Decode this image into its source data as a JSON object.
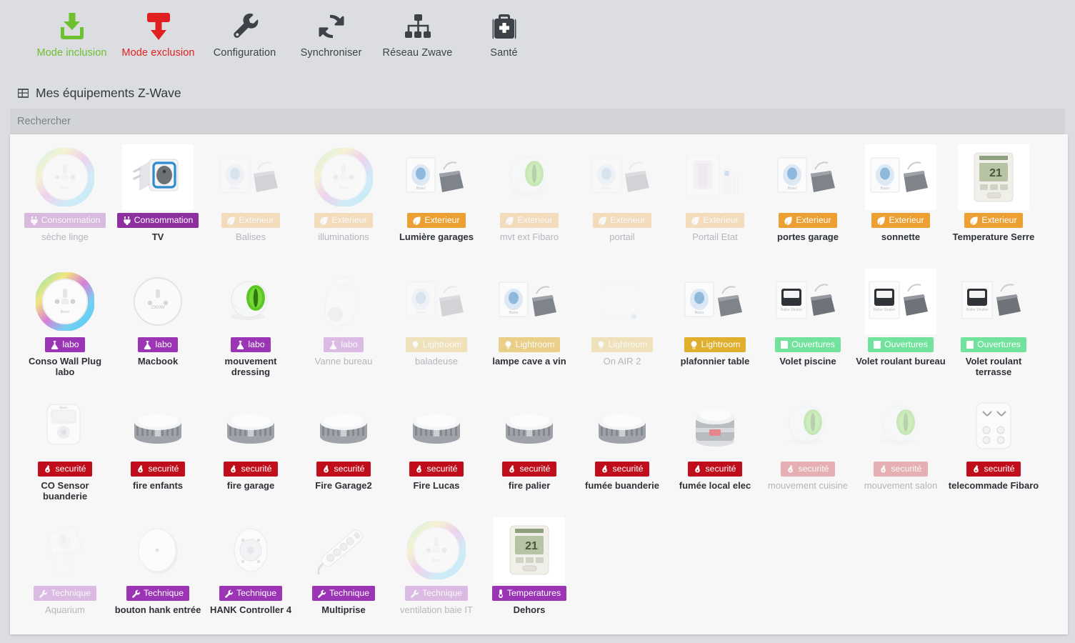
{
  "toolbar": [
    {
      "label": "Mode inclusion",
      "icon": "download-arrow-icon",
      "tone": "green"
    },
    {
      "label": "Mode exclusion",
      "icon": "upload-arrow-icon",
      "tone": "red"
    },
    {
      "label": "Configuration",
      "icon": "wrench-icon",
      "tone": "dark"
    },
    {
      "label": "Synchroniser",
      "icon": "sync-icon",
      "tone": "dark"
    },
    {
      "label": "Réseau Zwave",
      "icon": "sitemap-icon",
      "tone": "dark"
    },
    {
      "label": "Santé",
      "icon": "medical-bag-icon",
      "tone": "dark"
    }
  ],
  "section": {
    "icon": "grid-icon",
    "title": "Mes équipements Z-Wave"
  },
  "search": {
    "placeholder": "Rechercher",
    "value": ""
  },
  "categories": {
    "Consommation": {
      "color": "#8e2fa0",
      "icon": "plug-icon"
    },
    "Exterieur": {
      "color": "#eca033",
      "icon": "leaf-icon"
    },
    "labo": {
      "color": "#9c35b5",
      "icon": "flask-icon"
    },
    "Lightroom": {
      "color": "#e0af2e",
      "icon": "bulb-icon"
    },
    "Ouvertures": {
      "color": "#72e39c",
      "icon": "door-icon"
    },
    "securité": {
      "color": "#bf0d1c",
      "icon": "fire-icon"
    },
    "Technique": {
      "color": "#9c35b5",
      "icon": "wrench-icon"
    },
    "Temperatures": {
      "color": "#9c35b5",
      "icon": "thermometer-icon"
    }
  },
  "devices": [
    {
      "name": "sèche linge",
      "badge": "Consommation",
      "state": "off",
      "image": "wallplug-led"
    },
    {
      "name": "TV",
      "badge": "Consommation",
      "state": "on",
      "image": "smartplug-blue",
      "boxed": true
    },
    {
      "name": "Balises",
      "badge": "Exterieur",
      "state": "off",
      "image": "module-box"
    },
    {
      "name": "illuminations",
      "badge": "Exterieur",
      "state": "off",
      "image": "wallplug-led"
    },
    {
      "name": "Lumière garages",
      "badge": "Exterieur",
      "state": "on",
      "image": "module-box"
    },
    {
      "name": "mvt ext Fibaro",
      "badge": "Exterieur",
      "state": "off",
      "image": "motion-eye-green"
    },
    {
      "name": "portail",
      "badge": "Exterieur",
      "state": "off",
      "image": "module-box"
    },
    {
      "name": "Portail Etat",
      "badge": "Exterieur",
      "state": "off",
      "image": "sensor-box-pink"
    },
    {
      "name": "portes garage",
      "badge": "Exterieur",
      "state": "on",
      "image": "module-box"
    },
    {
      "name": "sonnette",
      "badge": "Exterieur",
      "state": "on",
      "image": "module-box",
      "boxed": true
    },
    {
      "name": "Temperature Serre",
      "badge": "Exterieur",
      "state": "on",
      "image": "lcd-thermostat",
      "boxed": true
    },
    {
      "name": "Conso Wall Plug labo",
      "badge": "labo",
      "state": "on",
      "image": "wallplug-led-blue"
    },
    {
      "name": "Macbook",
      "badge": "labo",
      "state": "on",
      "image": "wallplug-plain"
    },
    {
      "name": "mouvement dressing",
      "badge": "labo",
      "state": "on",
      "image": "motion-eye-green"
    },
    {
      "name": "Vanne bureau",
      "badge": "labo",
      "state": "off",
      "image": "valve"
    },
    {
      "name": "baladeuse",
      "badge": "Lightroom",
      "state": "off",
      "image": "module-box"
    },
    {
      "name": "lampe cave a vin",
      "badge": "Lightroom",
      "state": "mid",
      "image": "module-box"
    },
    {
      "name": "On AIR 2",
      "badge": "Lightroom",
      "state": "off",
      "image": "roundsensor"
    },
    {
      "name": "plafonnier table",
      "badge": "Lightroom",
      "state": "on",
      "image": "module-box"
    },
    {
      "name": "Volet piscine",
      "badge": "Ouvertures",
      "state": "on",
      "image": "roller-module"
    },
    {
      "name": "Volet roulant bureau",
      "badge": "Ouvertures",
      "state": "on",
      "image": "roller-module",
      "boxed": true
    },
    {
      "name": "Volet roulant terrasse",
      "badge": "Ouvertures",
      "state": "on",
      "image": "roller-module"
    },
    {
      "name": "CO Sensor buanderie",
      "badge": "securité",
      "state": "on",
      "image": "co-sensor"
    },
    {
      "name": "fire enfants",
      "badge": "securité",
      "state": "on",
      "image": "smoke-puck"
    },
    {
      "name": "fire garage",
      "badge": "securité",
      "state": "on",
      "image": "smoke-puck"
    },
    {
      "name": "Fire Garage2",
      "badge": "securité",
      "state": "on",
      "image": "smoke-puck"
    },
    {
      "name": "Fire Lucas",
      "badge": "securité",
      "state": "on",
      "image": "smoke-puck"
    },
    {
      "name": "fire palier",
      "badge": "securité",
      "state": "on",
      "image": "smoke-puck"
    },
    {
      "name": "fumée buanderie",
      "badge": "securité",
      "state": "on",
      "image": "smoke-puck"
    },
    {
      "name": "fumée local elec",
      "badge": "securité",
      "state": "on",
      "image": "siren"
    },
    {
      "name": "mouvement cuisine",
      "badge": "securité",
      "state": "off",
      "image": "motion-eye-green"
    },
    {
      "name": "mouvement salon",
      "badge": "securité",
      "state": "off",
      "image": "motion-eye-green"
    },
    {
      "name": "telecommade Fibaro",
      "badge": "securité",
      "state": "on",
      "image": "remote-keyfob"
    },
    {
      "name": "Aquarium",
      "badge": "Technique",
      "state": "off",
      "image": "plug-adapter"
    },
    {
      "name": "bouton hank entrée",
      "badge": "Technique",
      "state": "on",
      "image": "button-oval"
    },
    {
      "name": "HANK Controller 4",
      "badge": "Technique",
      "state": "on",
      "image": "remote-round"
    },
    {
      "name": "Multiprise",
      "badge": "Technique",
      "state": "on",
      "image": "power-strip"
    },
    {
      "name": "ventilation baie IT",
      "badge": "Technique",
      "state": "off",
      "image": "wallplug-led"
    },
    {
      "name": "Dehors",
      "badge": "Temperatures",
      "state": "on",
      "image": "lcd-thermostat",
      "boxed": true
    }
  ]
}
